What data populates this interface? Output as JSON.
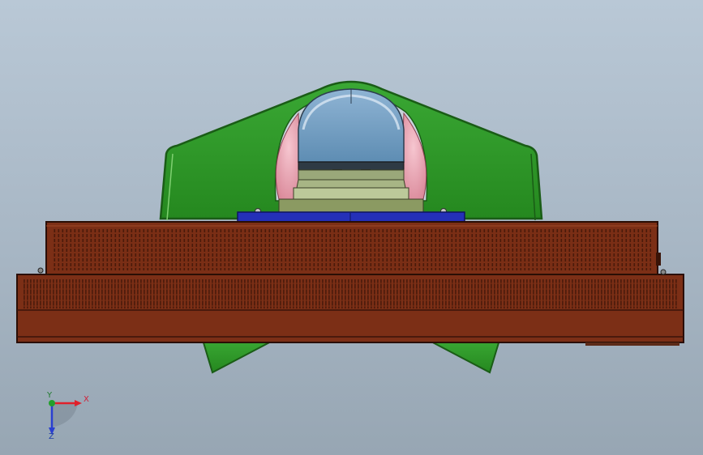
{
  "viewport": {
    "background_top": "#b9c8d6",
    "background_bottom": "#97a6b3"
  },
  "colors": {
    "housing_green": "#2e9c28",
    "housing_edge": "#1a5c16",
    "dome_glass": "#6d9bc0",
    "pink_pad": "#e8a4b2",
    "rail_blue": "#2430b8",
    "heatsink_brown": "#7c2f16",
    "heatsink_dark": "#4d1b0b",
    "olive_block": "#8b9a62"
  },
  "triad": {
    "x_label": "X",
    "y_label": "Y",
    "z_label": "Z",
    "x_color": "#e0202a",
    "y_color": "#22a02c",
    "z_color": "#2a3fd0"
  }
}
